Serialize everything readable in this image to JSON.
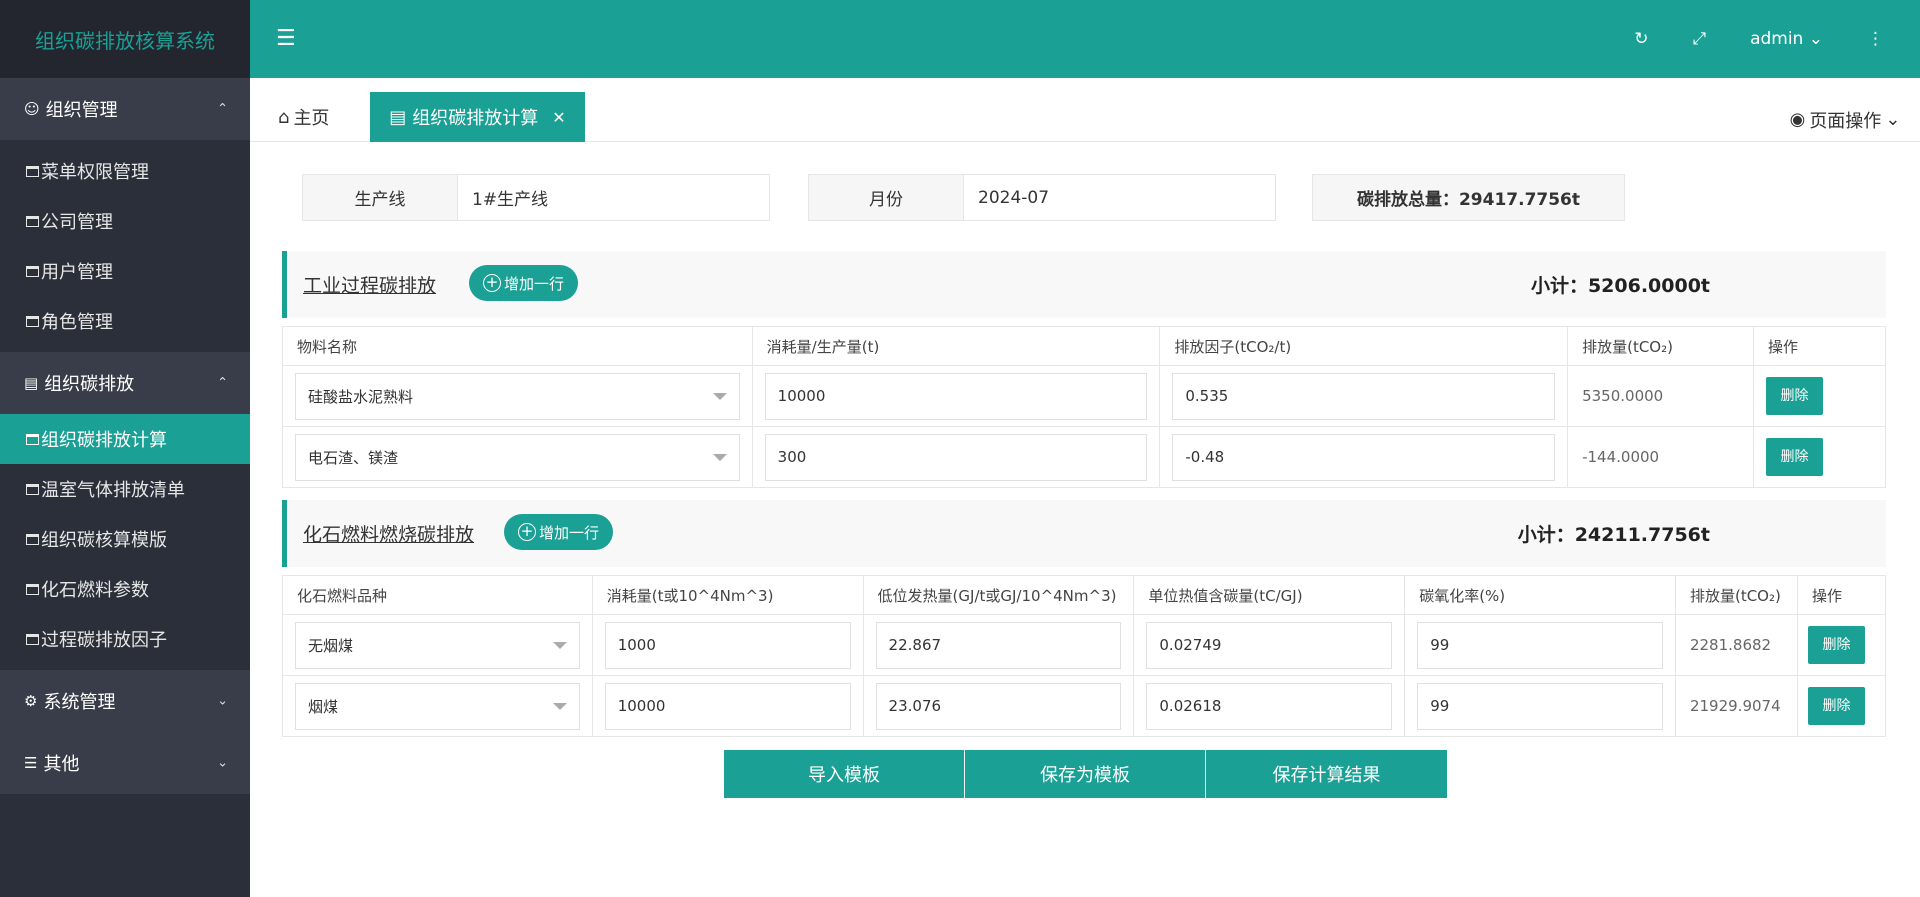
{
  "app": {
    "title": "组织碳排放核算系统"
  },
  "sidebar": {
    "groups": [
      {
        "label": "组织管理",
        "items": [
          "菜单权限管理",
          "公司管理",
          "用户管理",
          "角色管理"
        ]
      },
      {
        "label": "组织碳排放",
        "items": [
          "组织碳排放计算",
          "温室气体排放清单",
          "组织碳核算模版",
          "化石燃料参数",
          "过程碳排放因子"
        ]
      },
      {
        "label": "系统管理",
        "items": []
      },
      {
        "label": "其他",
        "items": []
      }
    ],
    "active_item": "组织碳排放计算"
  },
  "header": {
    "user": "admin"
  },
  "tabs": [
    {
      "label": "主页"
    },
    {
      "label": "组织碳排放计算",
      "active": true
    }
  ],
  "page_ops": "页面操作",
  "info": {
    "line_label": "生产线",
    "line_value": "1#生产线",
    "month_label": "月份",
    "month_value": "2024-07",
    "total": "碳排放总量：29417.7756t"
  },
  "industrial": {
    "title": "工业过程碳排放",
    "add_label": "增加一行",
    "subtotal": "小计：5206.0000t",
    "columns": [
      "物料名称",
      "消耗量/生产量(t)",
      "排放因子(tCO₂/t)",
      "排放量(tCO₂)",
      "操作"
    ],
    "rows": [
      {
        "material": "硅酸盐水泥熟料",
        "amount": "10000",
        "factor": "0.535",
        "emission": "5350.0000",
        "action": "删除"
      },
      {
        "material": "电石渣、镁渣",
        "amount": "300",
        "factor": "-0.48",
        "emission": "-144.0000",
        "action": "删除"
      }
    ]
  },
  "fossil": {
    "title": "化石燃料燃烧碳排放",
    "add_label": "增加一行",
    "subtotal": "小计：24211.7756t",
    "columns": [
      "化石燃料品种",
      "消耗量(t或10^4Nm^3)",
      "低位发热量(GJ/t或GJ/10^4Nm^3)",
      "单位热值含碳量(tC/GJ)",
      "碳氧化率(%)",
      "排放量(tCO₂)",
      "操作"
    ],
    "rows": [
      {
        "fuel": "无烟煤",
        "amount": "1000",
        "heat": "22.867",
        "carbon": "0.02749",
        "oxidation": "99",
        "emission": "2281.8682",
        "action": "删除"
      },
      {
        "fuel": "烟煤",
        "amount": "10000",
        "heat": "23.076",
        "carbon": "0.02618",
        "oxidation": "99",
        "emission": "21929.9074",
        "action": "删除"
      }
    ]
  },
  "buttons": {
    "import": "导入模板",
    "save_template": "保存为模板",
    "save_result": "保存计算结果"
  }
}
